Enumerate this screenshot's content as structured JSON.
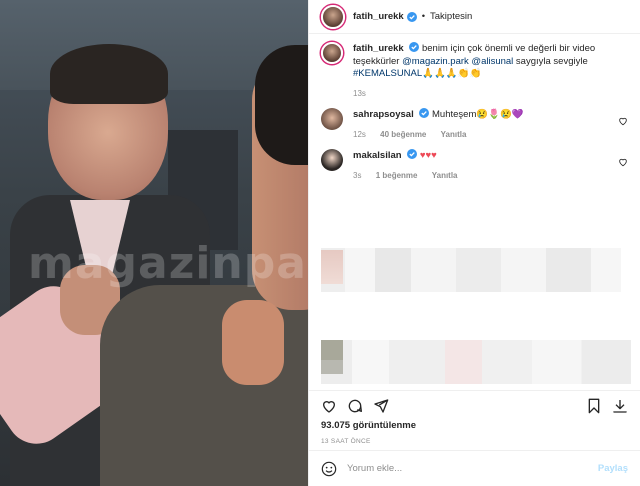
{
  "header": {
    "username": "fatih_urekk",
    "separator": "•",
    "follow_status": "Takiptesin"
  },
  "caption": {
    "username": "fatih_urekk",
    "text": "benim için çok önemli ve değerli bir video teşekkürler",
    "mention1": "@magazin.park",
    "mention2": "@alisunal",
    "text2": "saygıyla sevgiyle",
    "hashtag": "#KEMALSUNAL",
    "emojis": "🙏🙏🙏👏👏",
    "time": "13s"
  },
  "comments": [
    {
      "username": "sahrapsoysal",
      "text": "Muhteşem",
      "emojis": "😢🌷😢💜",
      "time": "12s",
      "likes": "40 beğenme",
      "reply": "Yanıtla"
    },
    {
      "username": "makalsilan",
      "text": "",
      "emojis": "♥♥♥",
      "time": "3s",
      "likes": "1 beğenme",
      "reply": "Yanıtla"
    }
  ],
  "media": {
    "watermark": "magazinpark"
  },
  "views": "93.075 görüntülenme",
  "posted": "13 SAAT ÖNCE",
  "comment_input": {
    "placeholder": "Yorum ekle...",
    "post_label": "Paylaş"
  },
  "colors": {
    "link": "#00376b",
    "meta": "#8e8e8e",
    "heart": "#ed4956",
    "verified": "#3897f0"
  }
}
